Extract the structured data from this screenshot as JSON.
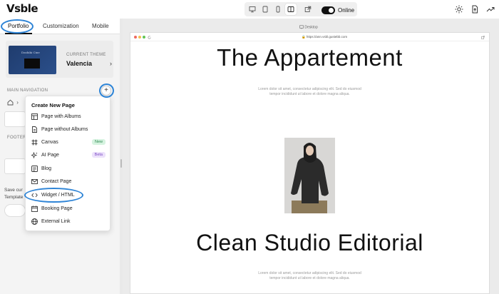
{
  "app": {
    "logo": "Vsble"
  },
  "topbar": {
    "status": "Online",
    "colors": {
      "toggle": "#111111"
    }
  },
  "tabs": [
    {
      "label": "Portfolio",
      "active": true
    },
    {
      "label": "Customization",
      "active": false
    },
    {
      "label": "Mobile",
      "active": false
    }
  ],
  "theme": {
    "label": "CURRENT THEME",
    "name": "Valencia",
    "thumb_text": "Dashiki Cine"
  },
  "nav": {
    "main_label": "MAIN NAVIGATION",
    "add_symbol": "+",
    "footer_label": "FOOTER",
    "note_line1": "Save cur",
    "note_line2": "Template"
  },
  "menu": {
    "title": "Create New Page",
    "items": [
      {
        "label": "Page with Albums",
        "icon": "layout-icon"
      },
      {
        "label": "Page without Albums",
        "icon": "file-icon"
      },
      {
        "label": "Canvas",
        "icon": "canvas-icon",
        "badge": "New"
      },
      {
        "label": "AI Page",
        "icon": "sparkle-icon",
        "badge": "Beta"
      },
      {
        "label": "Blog",
        "icon": "blog-icon"
      },
      {
        "label": "Contact Page",
        "icon": "mail-icon"
      },
      {
        "label": "Widget / HTML",
        "icon": "code-icon"
      },
      {
        "label": "Booking Page",
        "icon": "calendar-icon"
      },
      {
        "label": "External Link",
        "icon": "globe-icon"
      }
    ],
    "badge_colors": {
      "New": "#d6f3e0",
      "Beta": "#ece1fb"
    },
    "badge_text_colors": {
      "New": "#2e8a52",
      "Beta": "#7b4bc4"
    }
  },
  "preview": {
    "device_label": "Desktop",
    "url": "https://ann.vsbl.gustebb.com",
    "heading1": "The Appartement",
    "lorem1_line1": "Lorem dolor sit amet, consectetur adipiscing elit. Sed do eiusmod",
    "lorem1_line2": "tempor incididunt ut labore et dolore magna aliqua.",
    "heading2": "Clean Studio Editorial",
    "lorem2_line1": "Lorem dolor sit amet, consectetur adipiscing elit. Sed do eiusmod",
    "lorem2_line2": "tempor incididunt ut labore et dolore magna aliqua."
  },
  "colors": {
    "highlight_ring": "#2e84d6",
    "accent": "#111111"
  }
}
